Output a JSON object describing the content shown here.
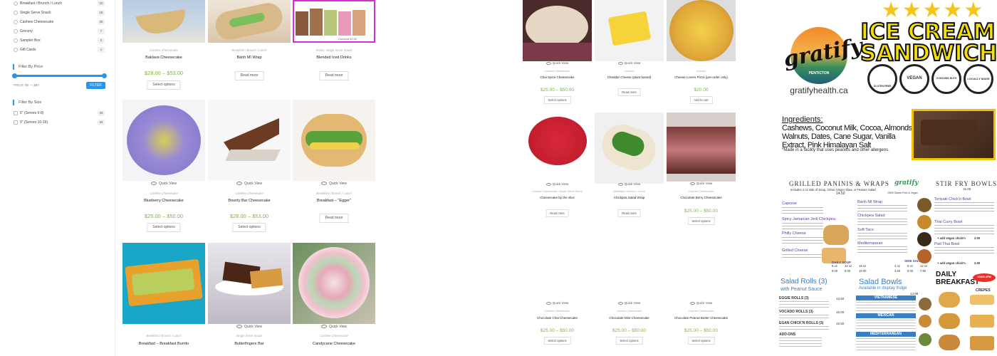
{
  "sidebar": {
    "categories": [
      {
        "label": "Breakfast / Brunch / Lunch",
        "count": "10"
      },
      {
        "label": "Single Serve Snack",
        "count": "15"
      },
      {
        "label": "Cashew Cheesecake",
        "count": "25"
      },
      {
        "label": "Grocery",
        "count": "7"
      },
      {
        "label": "Sampler Box",
        "count": "2"
      },
      {
        "label": "Gift Cards",
        "count": "1"
      }
    ],
    "price_heading": "Filter By Price",
    "price_range": "PRICE: $0 — $80",
    "filter_button": "FILTER",
    "size_heading": "Filter By Size",
    "sizes": [
      {
        "label": "6\" (Serves 6-8)",
        "count": "34"
      },
      {
        "label": "9\" (Serves 10-16)",
        "count": "34"
      }
    ]
  },
  "quick_view": "Quick View",
  "products_left": [
    {
      "category": "Cashew Cheesecake",
      "name": "Baklava Cheesecake",
      "price": "$28.00 – $53.00",
      "button": "Select options"
    },
    {
      "category": "Breakfast / Brunch / Lunch",
      "name": "Bánh Mì Wrap",
      "price": "",
      "button": "Read more"
    },
    {
      "category": "Drinks, Single Serve Snack",
      "name": "Blended Iced Drinks",
      "price": "",
      "button": "Read more",
      "overlay_text": "Coconut 30.50"
    },
    {
      "category": "Cashew Cheesecake",
      "name": "Blueberry Cheesecake",
      "price": "$25.00 – $50.00",
      "button": "Select options"
    },
    {
      "category": "Cashew Cheesecake",
      "name": "Bounty Bar Cheesecake",
      "price": "$28.00 – $53.00",
      "button": "Select options"
    },
    {
      "category": "Breakfast / Brunch / Lunch",
      "name": "Breakfast – \"Egger\"",
      "price": "",
      "button": "Read more"
    },
    {
      "category": "Breakfast / Brunch / Lunch",
      "name": "Breakfast – Breakfast Burrito",
      "price": "",
      "button": ""
    },
    {
      "category": "Single Serve Snack",
      "name": "Butterfingers Bar",
      "price": "",
      "button": ""
    },
    {
      "category": "Cashew Cheesecake",
      "name": "Candycane Cheesecake",
      "price": "",
      "button": ""
    }
  ],
  "products_right": [
    {
      "category": "Cashew Cheesecake",
      "name": "Chai Spice Cheesecake",
      "price": "$25.00 – $50.00",
      "button": "Select options"
    },
    {
      "category": "Grocery",
      "name": "Cheddar Cheese (plant based)",
      "price": "",
      "button": "Read more"
    },
    {
      "category": "Grocery",
      "name": "Cheese Lovers Pizza (pre-order only)",
      "price": "$20.00",
      "button": "Add to cart"
    },
    {
      "category": "Cashew Cheesecake, Single Serve Snack",
      "name": "Cheesecake by the slice",
      "price": "",
      "button": "Read more"
    },
    {
      "category": "Breakfast / Brunch / Lunch",
      "name": "Chickpea Salad Wrap",
      "price": "",
      "button": "Read more"
    },
    {
      "category": "Cashew Cheesecake",
      "name": "Chocolate Berry Cheesecake",
      "price": "$25.00 – $50.00",
      "button": "Select options"
    },
    {
      "category": "Cashew Cheesecake",
      "name": "Chocolate Chai Cheesecake",
      "price": "$25.00 – $50.00",
      "button": "Select options"
    },
    {
      "category": "Cashew Cheesecake",
      "name": "Chocolate Mint Cheesecake",
      "price": "$25.00 – $50.00",
      "button": "Select options"
    },
    {
      "category": "Cashew Cheesecake",
      "name": "Chocolate Peanut Butter Cheesecake",
      "price": "$25.00 – $50.00",
      "button": "Select options"
    }
  ],
  "ad": {
    "logo_word": "gratify",
    "logo_sub": "PENTICTON",
    "website": "gratifyhealth.ca",
    "title_line1": "ICE CREAM",
    "title_line2": "SANDWICH",
    "badges": [
      "GLUTEN FREE",
      "VEGAN",
      "CONTAINS NUTS",
      "LOCALLY MADE"
    ],
    "ingredients_heading": "Ingredients:",
    "ingredients_line1": "Cashews, Coconut Milk, Cocoa, Almonds,",
    "ingredients_line2": "Walnuts, Dates, Cane Sugar, Vanilla",
    "ingredients_line3": "Extract, Pink Himalayan Salt",
    "disclaimer": "*Made in a facility that uses peanuts and other allergens."
  },
  "menu": {
    "paninis_title": "GRILLED PANINIS & WRAPS",
    "paninis_sub": "Includes 4 oz side of Soup, Citrus Ginger Slaw, or Feature Salad",
    "paninis_price": "14.50",
    "gluten_note": "100% Gluten Free & Vegan",
    "left_items": [
      "Caprese",
      "Spicy Jamaican Jerk Chickpea",
      "Philly Cheese",
      "Grilled Cheese"
    ],
    "mid_items": [
      "Bánh Mì Wrap",
      "Chickpea Salad",
      "Soft Taco",
      "Mediterranean"
    ],
    "stirfry_title": "STIR FRY BOWLS",
    "stirfry_price": "15.00",
    "stirfry_items": [
      "Teriyaki Chick'n Bowl",
      "Thai Curry Bowl",
      "Pad Thai Bowl"
    ],
    "addon_a": "+ add vegan chick'n",
    "addon_a_price": "2.00",
    "addon_b": "+ add vegan chick'n",
    "addon_b_price": "2.00",
    "soup_label": "DAILY SOUP",
    "soup_sizes": [
      "8 oz",
      "12 oz",
      "16 oz"
    ],
    "soup_prices": [
      "6.00",
      "8.00",
      "10.00"
    ],
    "side_label": "SIDE SALAD",
    "side_sizes": [
      "4 oz",
      "8 oz",
      "12 oz"
    ],
    "side_prices": [
      "3.50",
      "5.00",
      "7.50"
    ],
    "salad_rolls_title": "Salad Rolls (3)",
    "salad_rolls_sub": "with Peanut Sauce",
    "rolls": [
      {
        "name": "EGGIE ROLLS (3)",
        "price": "13.50"
      },
      {
        "name": "VOCADO ROLLS (3)",
        "price": "15.00"
      },
      {
        "name": "EGAN CHICK'N ROLLS (3)",
        "price": "15.50"
      },
      {
        "name": "ADD-ONS",
        "price": ""
      }
    ],
    "salad_bowls_title": "Salad Bowls",
    "salad_bowls_sub": "Available in display fridge",
    "salad_bowls_price": "14.99",
    "bowls": [
      "VIETNAMESE",
      "MEXICAN",
      "MEDITERRANEAN"
    ],
    "breakfast_label": "DAILY BREAKFAST",
    "crepes_label": "CREPES",
    "breakfast_time": "10AM-2PM"
  },
  "colors": {
    "accent": "#2196f3",
    "price": "#7cb342",
    "stars": "#f5c518",
    "icecream_text": "#f6e000"
  }
}
